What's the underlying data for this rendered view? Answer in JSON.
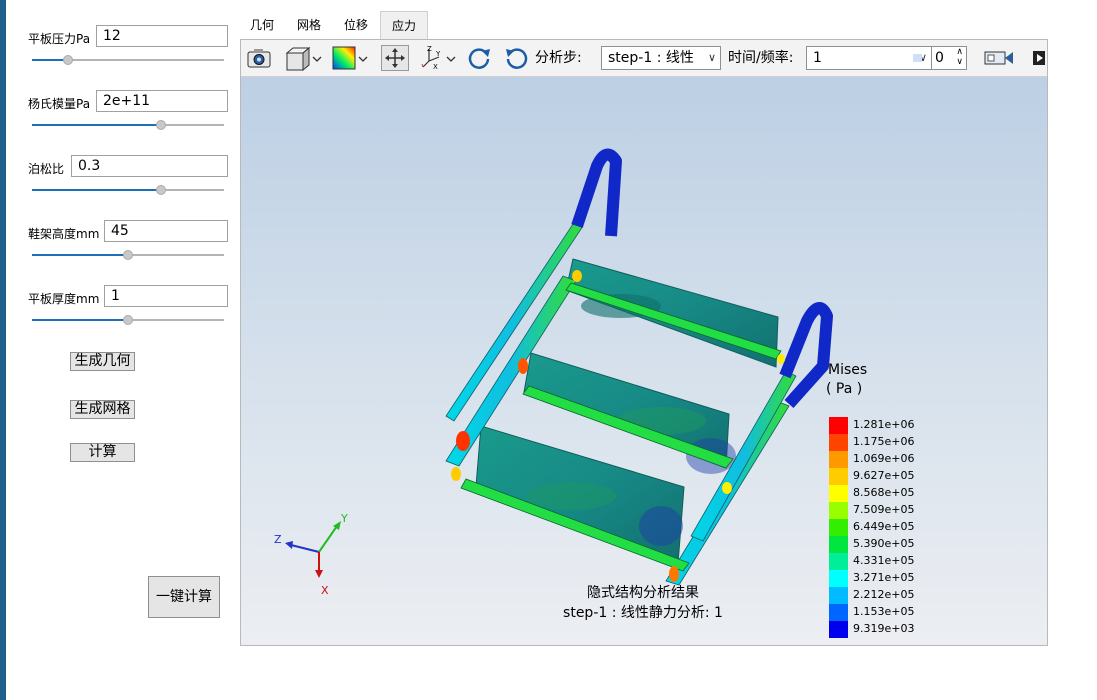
{
  "params": [
    {
      "label": "平板压力Pa",
      "value": "12",
      "slider_fraction": 0.19
    },
    {
      "label": "杨氏模量Pa",
      "value": "2e+11",
      "slider_fraction": 0.67
    },
    {
      "label": "泊松比",
      "value": "0.3",
      "slider_fraction": 0.67
    },
    {
      "label": "鞋架高度mm",
      "value": "45",
      "slider_fraction": 0.5
    },
    {
      "label": "平板厚度mm",
      "value": "1",
      "slider_fraction": 0.5
    }
  ],
  "buttons": {
    "gen_geometry": "生成几何",
    "gen_mesh": "生成网格",
    "compute": "计算",
    "one_click": "一键计算"
  },
  "tabs": [
    {
      "label": "几何"
    },
    {
      "label": "网格"
    },
    {
      "label": "位移"
    },
    {
      "label": "应力",
      "active": true
    }
  ],
  "toolbar": {
    "step_label": "分析步:",
    "step_value": "step-1 : 线性",
    "time_label": "时间/频率:",
    "time_value": "1",
    "frame_value": "0"
  },
  "legend": {
    "title": "Mises",
    "unit": "( Pa )",
    "entries": [
      {
        "value": "1.281e+06",
        "color": "#ff0000"
      },
      {
        "value": "1.175e+06",
        "color": "#ff4400"
      },
      {
        "value": "1.069e+06",
        "color": "#ff9900"
      },
      {
        "value": "9.627e+05",
        "color": "#ffcc00"
      },
      {
        "value": "8.568e+05",
        "color": "#ffff00"
      },
      {
        "value": "7.509e+05",
        "color": "#99ff00"
      },
      {
        "value": "6.449e+05",
        "color": "#33ee00"
      },
      {
        "value": "5.390e+05",
        "color": "#00e640"
      },
      {
        "value": "4.331e+05",
        "color": "#00ee99"
      },
      {
        "value": "3.271e+05",
        "color": "#00ffff"
      },
      {
        "value": "2.212e+05",
        "color": "#00bbff"
      },
      {
        "value": "1.153e+05",
        "color": "#0066ff"
      },
      {
        "value": "9.319e+03",
        "color": "#0000ee"
      }
    ]
  },
  "caption": {
    "line1": "隐式结构分析结果",
    "line2": "step-1 : 线性静力分析: 1"
  },
  "axes": {
    "x": "X",
    "y": "Y",
    "z": "Z"
  }
}
